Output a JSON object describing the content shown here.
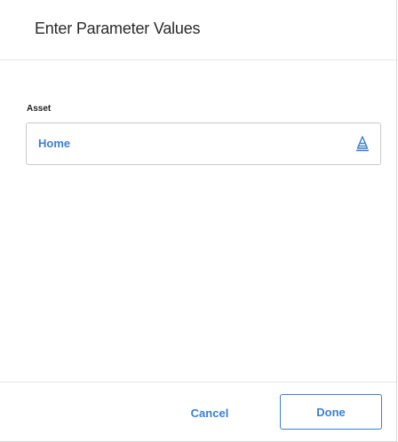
{
  "dialog": {
    "title": "Enter Parameter Values"
  },
  "fields": {
    "asset": {
      "label": "Asset",
      "value": "Home",
      "icon": "hierarchy-icon"
    }
  },
  "footer": {
    "cancel_label": "Cancel",
    "done_label": "Done"
  },
  "colors": {
    "accent": "#3b7fd1",
    "border": "#c9c9c9",
    "divider": "#e6e6e6",
    "title_text": "#2b2b2b"
  }
}
